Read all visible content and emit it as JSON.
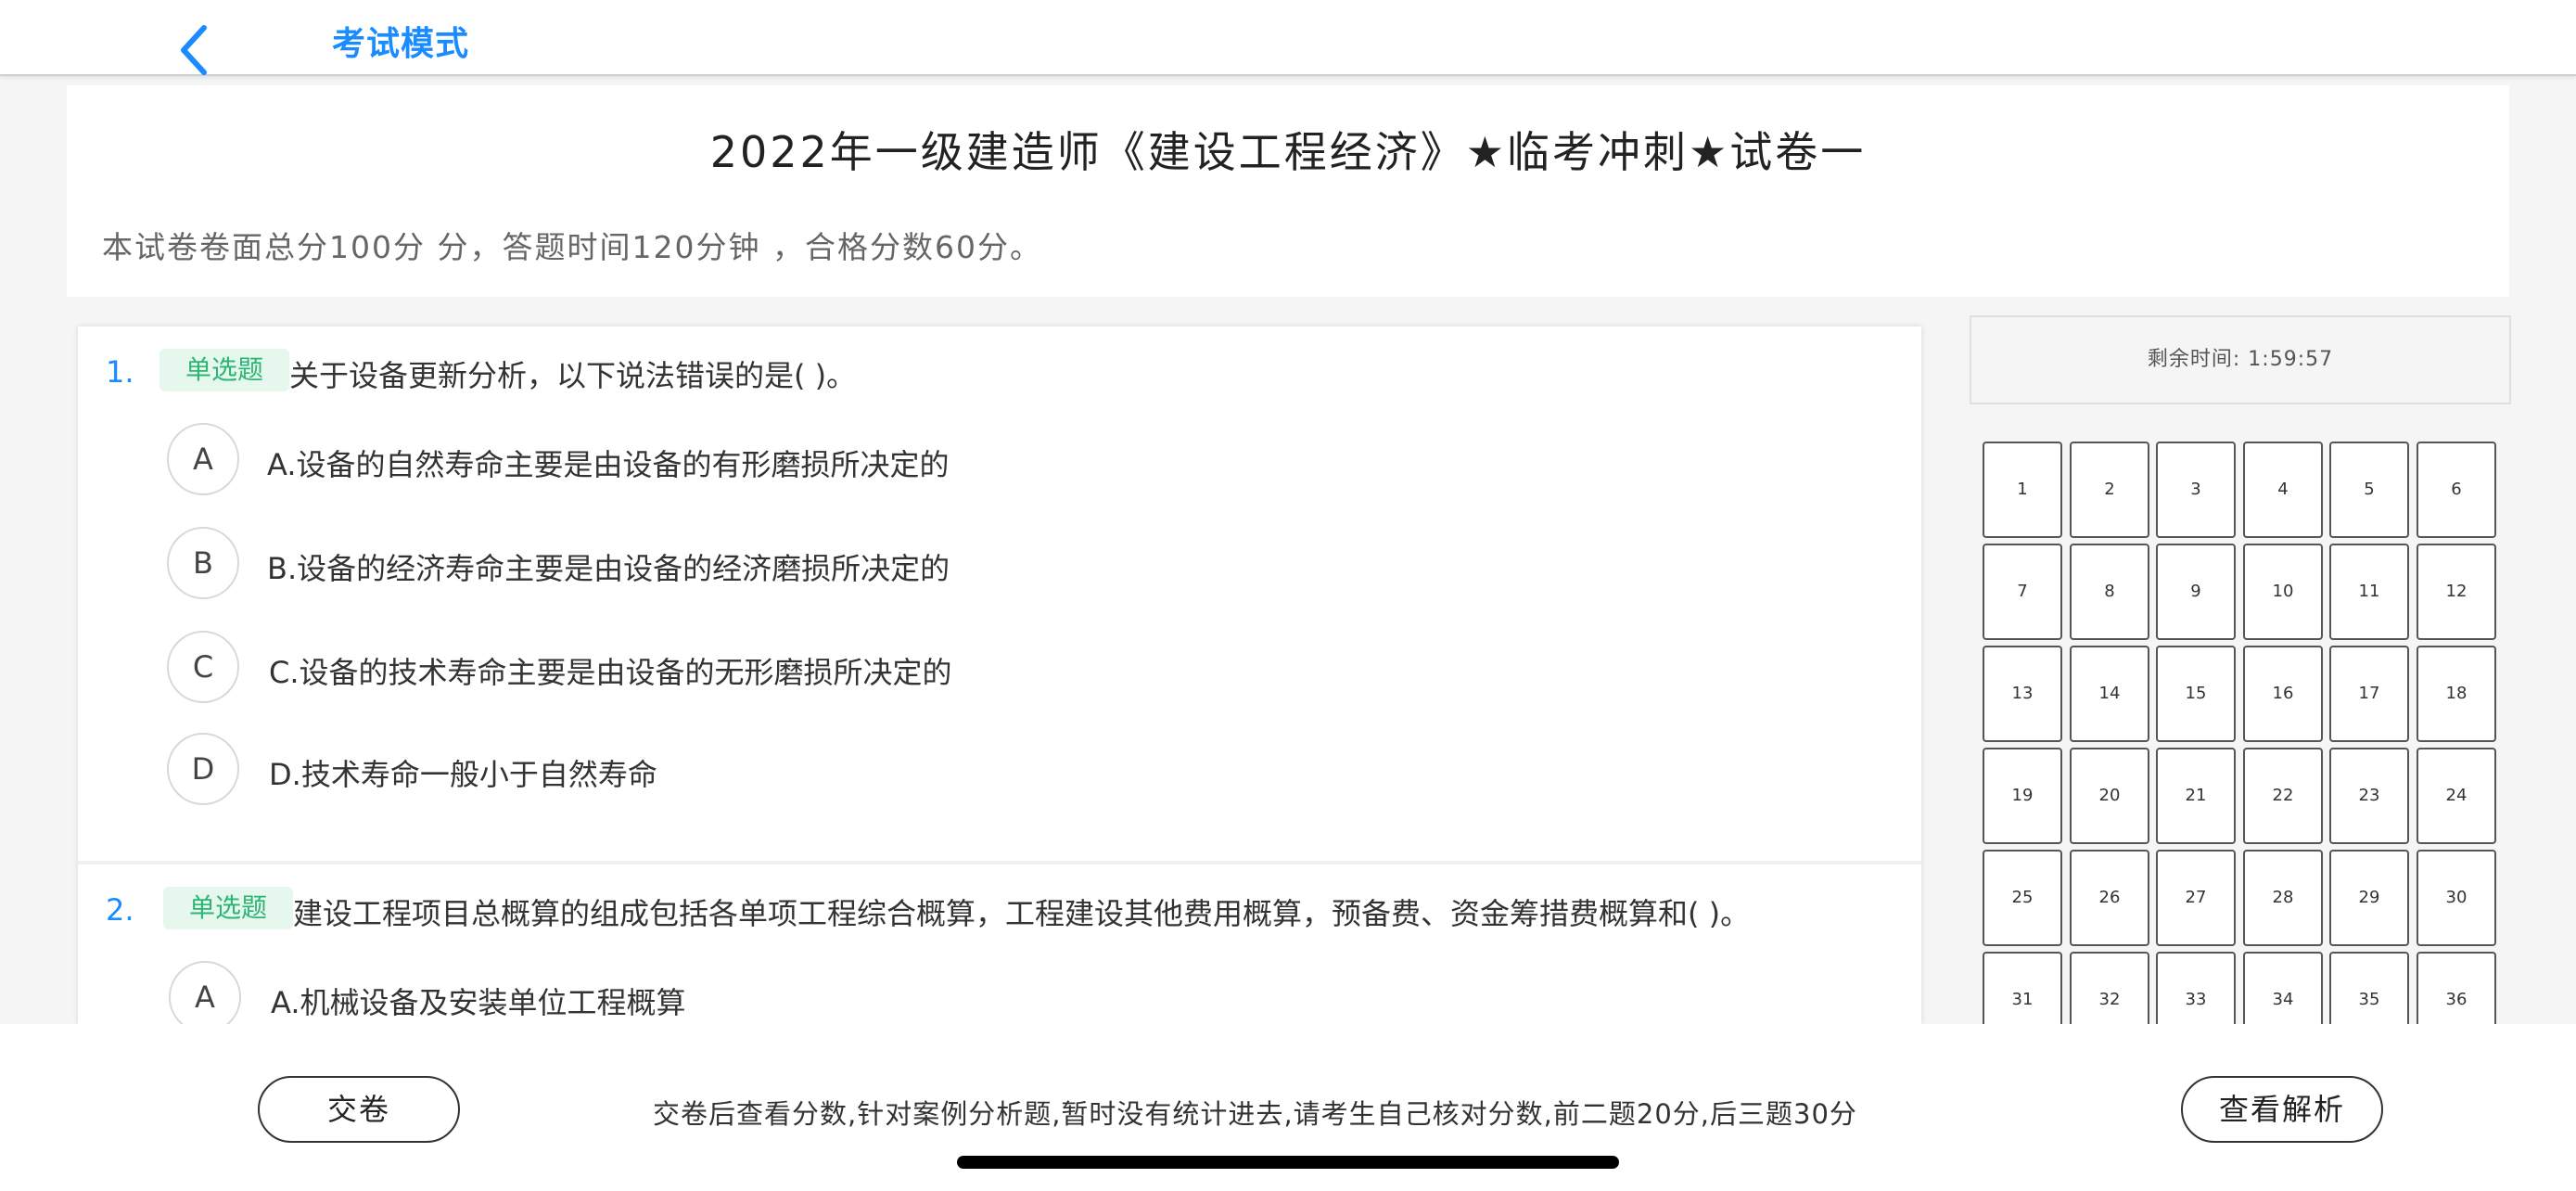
{
  "nav": {
    "title": "考试模式",
    "back_icon": "chevron-left-icon",
    "accent": "#1a8cff"
  },
  "header": {
    "paper_title": "2022年一级建造师《建设工程经济》★临考冲刺★试卷一",
    "paper_info": "本试卷卷面总分100分 分，答题时间120分钟 ，合格分数60分。"
  },
  "questions": [
    {
      "number": "1.",
      "type": "单选题",
      "stem": "关于设备更新分析，以下说法错误的是(    )。",
      "options": [
        {
          "letter": "A",
          "text": "A.设备的自然寿命主要是由设备的有形磨损所决定的"
        },
        {
          "letter": "B",
          "text": "B.设备的经济寿命主要是由设备的经济磨损所决定的"
        },
        {
          "letter": "C",
          "text": "C.设备的技术寿命主要是由设备的无形磨损所决定的"
        },
        {
          "letter": "D",
          "text": "D.技术寿命一般小于自然寿命"
        }
      ]
    },
    {
      "number": "2.",
      "type": "单选题",
      "stem": "建设工程项目总概算的组成包括各单项工程综合概算，工程建设其他费用概算，预备费、资金筹措费概算和(    )。",
      "options": [
        {
          "letter": "A",
          "text": "A.机械设备及安装单位工程概算"
        }
      ]
    }
  ],
  "timer": {
    "label": "剩余时间: 1:59:57"
  },
  "answer_sheet": [
    "1",
    "2",
    "3",
    "4",
    "5",
    "6",
    "7",
    "8",
    "9",
    "10",
    "11",
    "12",
    "13",
    "14",
    "15",
    "16",
    "17",
    "18",
    "19",
    "20",
    "21",
    "22",
    "23",
    "24",
    "25",
    "26",
    "27",
    "28",
    "29",
    "30",
    "31",
    "32",
    "33",
    "34",
    "35",
    "36"
  ],
  "bottom": {
    "submit_label": "交卷",
    "notice": "交卷后查看分数,针对案例分析题,暂时没有统计进去,请考生自己核对分数,前二题20分,后三题30分",
    "view_analysis_label": "查看解析"
  },
  "colors": {
    "tag_bg": "#e6f7ee",
    "tag_text": "#2bb673"
  }
}
